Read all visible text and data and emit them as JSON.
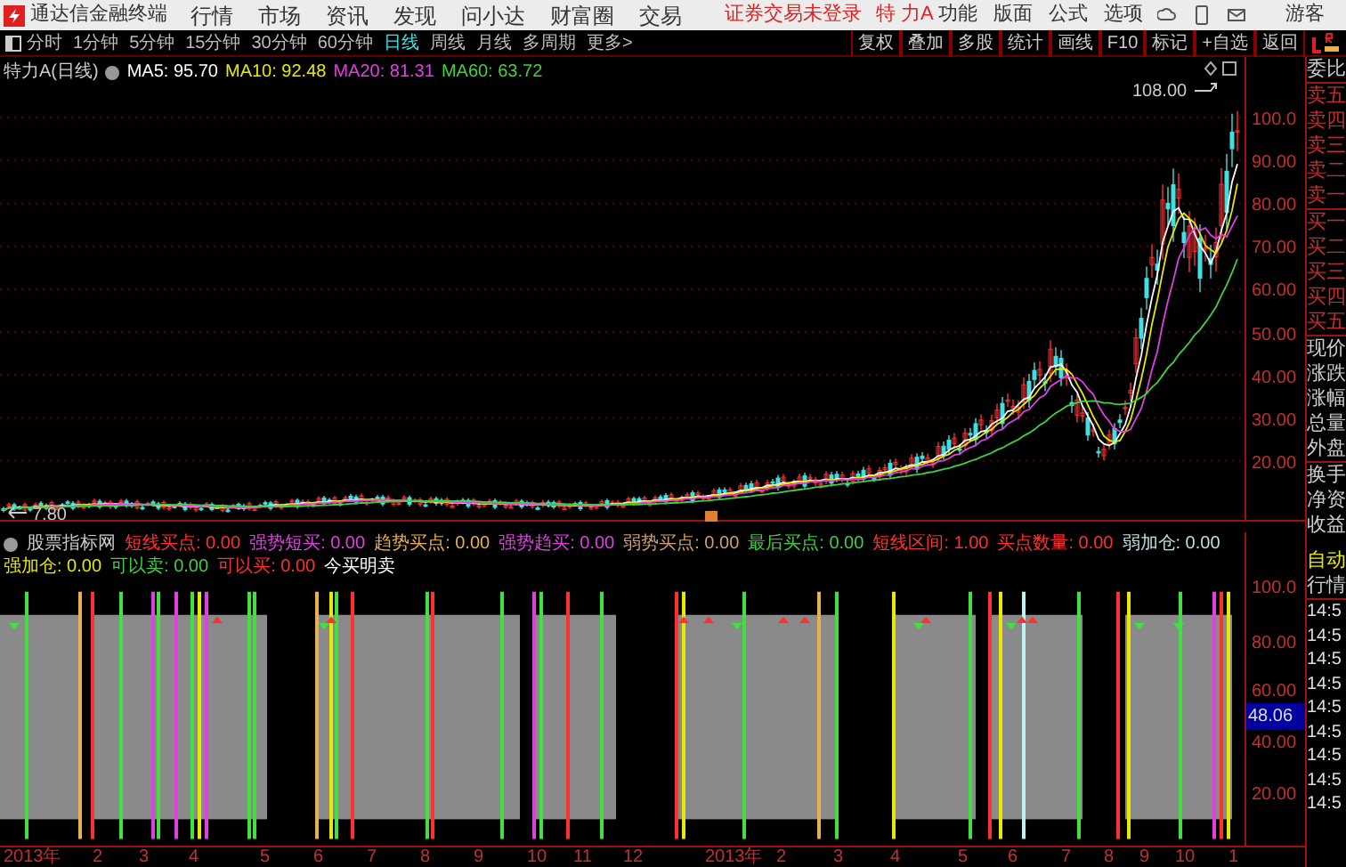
{
  "window": {
    "app_title": "通达信金融终端",
    "menu": [
      "行情",
      "市场",
      "资讯",
      "发现",
      "问小达",
      "财富圈",
      "交易"
    ],
    "login_status": "证券交易未登录",
    "stock": "特 力A",
    "right_menu": [
      "功能",
      "版面",
      "公式",
      "选项"
    ],
    "user": "游客"
  },
  "period_tabs": [
    {
      "label": "分时",
      "selected": false
    },
    {
      "label": "1分钟",
      "selected": false
    },
    {
      "label": "5分钟",
      "selected": false
    },
    {
      "label": "15分钟",
      "selected": false
    },
    {
      "label": "30分钟",
      "selected": false
    },
    {
      "label": "60分钟",
      "selected": false
    },
    {
      "label": "日线",
      "selected": true
    },
    {
      "label": "周线",
      "selected": false
    },
    {
      "label": "月线",
      "selected": false
    },
    {
      "label": "多周期",
      "selected": false
    },
    {
      "label": "更多>",
      "selected": false
    }
  ],
  "tool_buttons": [
    "复权",
    "叠加",
    "多股",
    "统计",
    "画线",
    "F10",
    "标记",
    "+自选",
    "返回"
  ],
  "legend": {
    "title": "特力A(日线)",
    "averages": [
      {
        "label": "MA5: 95.70",
        "color": "#ffffff"
      },
      {
        "label": "MA10: 92.48",
        "color": "#e8e800"
      },
      {
        "label": "MA20: 81.31",
        "color": "#e040e0"
      },
      {
        "label": "MA60: 63.72",
        "color": "#40d040"
      }
    ]
  },
  "price_axis": [
    "100.0",
    "90.00",
    "80.00",
    "70.00",
    "60.00",
    "50.00",
    "40.00",
    "30.00",
    "20.00"
  ],
  "high_label": "108.00",
  "low_label": "7.80",
  "indicator": {
    "name": "股票指标网",
    "items": [
      {
        "label": "短线买点:",
        "value": "0.00",
        "color": "#ff3030"
      },
      {
        "label": "强势短买:",
        "value": "0.00",
        "color": "#e040e0"
      },
      {
        "label": "趋势买点:",
        "value": "0.00",
        "color": "#e8b050"
      },
      {
        "label": "强势趋买:",
        "value": "0.00",
        "color": "#e040e0"
      },
      {
        "label": "弱势买点:",
        "value": "0.00",
        "color": "#d0a070"
      },
      {
        "label": "最后买点:",
        "value": "0.00",
        "color": "#40d040"
      },
      {
        "label": "短线区间:",
        "value": "1.00",
        "color": "#ff3030"
      },
      {
        "label": "买点数量:",
        "value": "0.00",
        "color": "#ff3030"
      },
      {
        "label": "弱加仓:",
        "value": "0.00",
        "color": "#c0e0e0"
      },
      {
        "label": "强加仓:",
        "value": "0.00",
        "color": "#e8e800"
      },
      {
        "label": "可以卖:",
        "value": "0.00",
        "color": "#40d040"
      },
      {
        "label": "可以买:",
        "value": "0.00",
        "color": "#ff3030"
      },
      {
        "label": "今买明卖",
        "color": "#ffffff"
      }
    ]
  },
  "indicator_axis": [
    "100.0",
    "80.00",
    "60.00",
    "40.00",
    "20.00"
  ],
  "indicator_current": "48.06",
  "time_axis": [
    "2013年",
    "2",
    "3",
    "4",
    "5",
    "6",
    "7",
    "8",
    "9",
    "10",
    "11",
    "12",
    "2013年",
    "2",
    "3",
    "4",
    "5",
    "6",
    "7",
    "8",
    "9",
    "10",
    "1"
  ],
  "quote_panel": {
    "labels": [
      "委比",
      "卖五",
      "卖四",
      "卖三",
      "卖二",
      "卖一",
      "买一",
      "买二",
      "买三",
      "买四",
      "买五",
      "现价",
      "涨跌",
      "涨幅",
      "总量",
      "外盘",
      "换手",
      "净资",
      "收益"
    ],
    "mode": "自动",
    "tab": "行情",
    "times": [
      "14:5",
      "14:5",
      "14:5",
      "14:5",
      "14:5",
      "14:5",
      "14:5",
      "14:5",
      "14:5"
    ]
  }
}
